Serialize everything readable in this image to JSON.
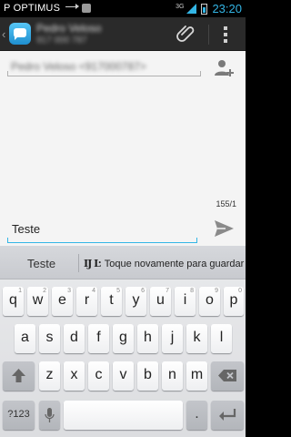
{
  "status_bar": {
    "carrier": "P OPTIMUS",
    "network": "3G",
    "time": "23:20"
  },
  "action_bar": {
    "title": "Pedro Veloso",
    "subtitle": "917 000 787",
    "back_icon": "back-chevron-icon",
    "app_icon": "messaging-app-icon",
    "attach_icon": "paperclip-icon",
    "menu_icon": "overflow-menu-icon"
  },
  "recipient": {
    "value": "Pedro Veloso <917000787>",
    "add_icon": "add-contact-icon"
  },
  "compose": {
    "char_count": "155/1",
    "value": "Teste",
    "send_icon": "send-icon"
  },
  "keyboard": {
    "suggestion": "Teste",
    "hint_glyph": "IJ Ŀ",
    "hint_text": "Toque novamente para guardar",
    "row1": [
      {
        "label": "q",
        "hint": "1"
      },
      {
        "label": "w",
        "hint": "2"
      },
      {
        "label": "e",
        "hint": "3"
      },
      {
        "label": "r",
        "hint": "4"
      },
      {
        "label": "t",
        "hint": "5"
      },
      {
        "label": "y",
        "hint": "6"
      },
      {
        "label": "u",
        "hint": "7"
      },
      {
        "label": "i",
        "hint": "8"
      },
      {
        "label": "o",
        "hint": "9"
      },
      {
        "label": "p",
        "hint": "0"
      }
    ],
    "row2": [
      "a",
      "s",
      "d",
      "f",
      "g",
      "h",
      "j",
      "k",
      "l"
    ],
    "row3": [
      "z",
      "x",
      "c",
      "v",
      "b",
      "n",
      "m"
    ],
    "symbols_key": "?123",
    "period_key": ".",
    "accent_color": "#33b5e5"
  }
}
